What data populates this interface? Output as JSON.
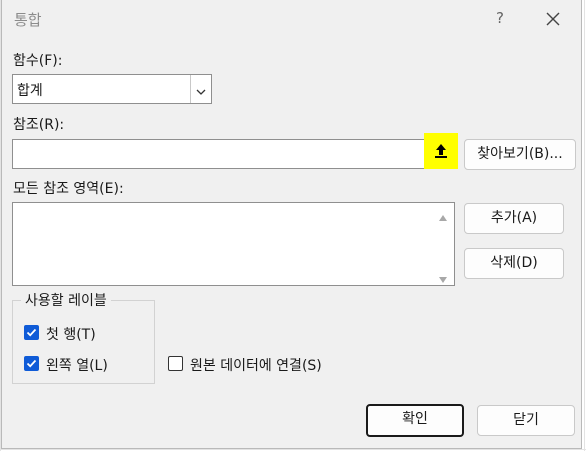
{
  "dialog": {
    "title": "통합",
    "help_label": "?",
    "close_icon": "close-icon"
  },
  "function": {
    "label": "함수(F):",
    "selected": "합계"
  },
  "reference": {
    "label": "참조(R):",
    "value": "",
    "collapse_icon": "upload-arrow-icon",
    "highlight_color": "#ffff00",
    "browse_label": "찾아보기(B)..."
  },
  "all_references": {
    "label": "모든 참조 영역(E):",
    "items": [],
    "add_label": "추가(A)",
    "delete_label": "삭제(D)"
  },
  "use_labels": {
    "title": "사용할 레이블",
    "top_row": {
      "label": "첫 행(T)",
      "checked": true
    },
    "left_column": {
      "label": "왼쪽 열(L)",
      "checked": true
    }
  },
  "link_to_source": {
    "label": "원본 데이터에 연결(S)",
    "checked": false
  },
  "footer": {
    "ok_label": "확인",
    "close_label": "닫기"
  },
  "colors": {
    "accent": "#0f5bd7",
    "dialog_bg": "#f0f0f0"
  }
}
